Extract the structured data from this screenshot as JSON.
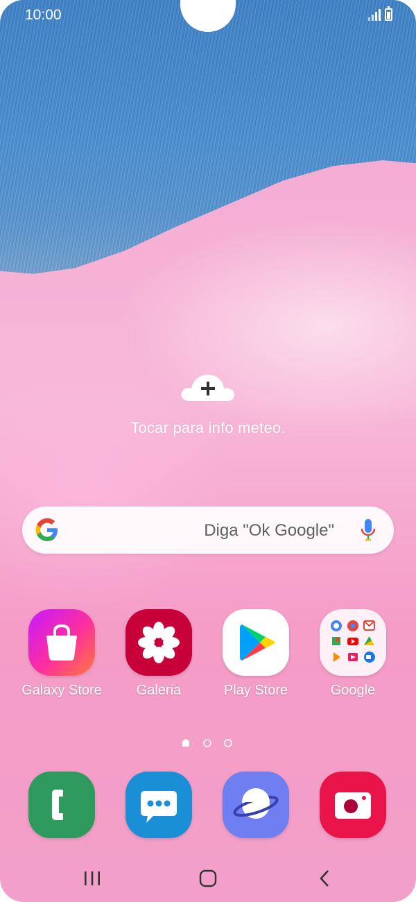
{
  "status_bar": {
    "time": "10:00",
    "icons": [
      "signal-icon",
      "battery-charging-icon"
    ]
  },
  "weather_widget": {
    "text": "Tocar para info meteo.",
    "icon": "cloud-plus-icon"
  },
  "search_bar": {
    "placeholder": "Diga \"Ok Google\"",
    "logo": "google-g-icon",
    "mic_icon": "mic-icon"
  },
  "apps": [
    {
      "label": "Galaxy Store",
      "icon": "shopping-bag-icon"
    },
    {
      "label": "Galeria",
      "icon": "flower-icon"
    },
    {
      "label": "Play Store",
      "icon": "play-store-icon"
    },
    {
      "label": "Google",
      "icon": "google-folder-icon"
    }
  ],
  "page_indicator": {
    "pages": 3,
    "current": 1
  },
  "dock": [
    {
      "name": "phone",
      "icon": "phone-icon",
      "color": "#2e9a5e"
    },
    {
      "name": "messages",
      "icon": "message-icon",
      "color": "#1a8fd6"
    },
    {
      "name": "internet",
      "icon": "planet-icon",
      "color": "#6f7ef0"
    },
    {
      "name": "camera",
      "icon": "camera-icon",
      "color": "#e8144a"
    }
  ],
  "nav_bar": {
    "buttons": [
      "recents-button",
      "home-button",
      "back-button"
    ]
  },
  "colors": {
    "wallpaper_blue": "#4a92d8",
    "wallpaper_pink": "#f5a8cf"
  }
}
